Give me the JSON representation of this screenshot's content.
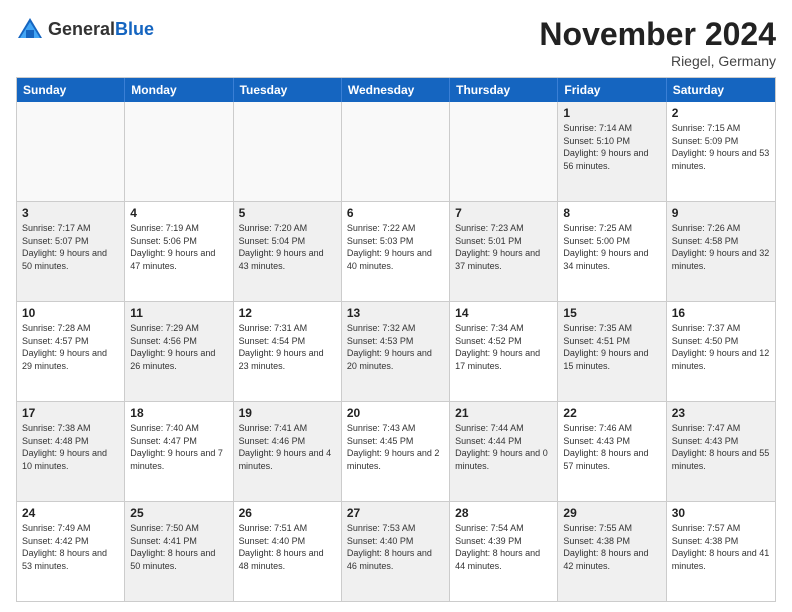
{
  "logo": {
    "general": "General",
    "blue": "Blue"
  },
  "title": "November 2024",
  "subtitle": "Riegel, Germany",
  "headers": [
    "Sunday",
    "Monday",
    "Tuesday",
    "Wednesday",
    "Thursday",
    "Friday",
    "Saturday"
  ],
  "rows": [
    [
      {
        "day": "",
        "info": "",
        "empty": true
      },
      {
        "day": "",
        "info": "",
        "empty": true
      },
      {
        "day": "",
        "info": "",
        "empty": true
      },
      {
        "day": "",
        "info": "",
        "empty": true
      },
      {
        "day": "",
        "info": "",
        "empty": true
      },
      {
        "day": "1",
        "info": "Sunrise: 7:14 AM\nSunset: 5:10 PM\nDaylight: 9 hours and 56 minutes.",
        "shaded": true
      },
      {
        "day": "2",
        "info": "Sunrise: 7:15 AM\nSunset: 5:09 PM\nDaylight: 9 hours and 53 minutes.",
        "shaded": false
      }
    ],
    [
      {
        "day": "3",
        "info": "Sunrise: 7:17 AM\nSunset: 5:07 PM\nDaylight: 9 hours and 50 minutes.",
        "shaded": true
      },
      {
        "day": "4",
        "info": "Sunrise: 7:19 AM\nSunset: 5:06 PM\nDaylight: 9 hours and 47 minutes.",
        "shaded": false
      },
      {
        "day": "5",
        "info": "Sunrise: 7:20 AM\nSunset: 5:04 PM\nDaylight: 9 hours and 43 minutes.",
        "shaded": true
      },
      {
        "day": "6",
        "info": "Sunrise: 7:22 AM\nSunset: 5:03 PM\nDaylight: 9 hours and 40 minutes.",
        "shaded": false
      },
      {
        "day": "7",
        "info": "Sunrise: 7:23 AM\nSunset: 5:01 PM\nDaylight: 9 hours and 37 minutes.",
        "shaded": true
      },
      {
        "day": "8",
        "info": "Sunrise: 7:25 AM\nSunset: 5:00 PM\nDaylight: 9 hours and 34 minutes.",
        "shaded": false
      },
      {
        "day": "9",
        "info": "Sunrise: 7:26 AM\nSunset: 4:58 PM\nDaylight: 9 hours and 32 minutes.",
        "shaded": true
      }
    ],
    [
      {
        "day": "10",
        "info": "Sunrise: 7:28 AM\nSunset: 4:57 PM\nDaylight: 9 hours and 29 minutes.",
        "shaded": false
      },
      {
        "day": "11",
        "info": "Sunrise: 7:29 AM\nSunset: 4:56 PM\nDaylight: 9 hours and 26 minutes.",
        "shaded": true
      },
      {
        "day": "12",
        "info": "Sunrise: 7:31 AM\nSunset: 4:54 PM\nDaylight: 9 hours and 23 minutes.",
        "shaded": false
      },
      {
        "day": "13",
        "info": "Sunrise: 7:32 AM\nSunset: 4:53 PM\nDaylight: 9 hours and 20 minutes.",
        "shaded": true
      },
      {
        "day": "14",
        "info": "Sunrise: 7:34 AM\nSunset: 4:52 PM\nDaylight: 9 hours and 17 minutes.",
        "shaded": false
      },
      {
        "day": "15",
        "info": "Sunrise: 7:35 AM\nSunset: 4:51 PM\nDaylight: 9 hours and 15 minutes.",
        "shaded": true
      },
      {
        "day": "16",
        "info": "Sunrise: 7:37 AM\nSunset: 4:50 PM\nDaylight: 9 hours and 12 minutes.",
        "shaded": false
      }
    ],
    [
      {
        "day": "17",
        "info": "Sunrise: 7:38 AM\nSunset: 4:48 PM\nDaylight: 9 hours and 10 minutes.",
        "shaded": true
      },
      {
        "day": "18",
        "info": "Sunrise: 7:40 AM\nSunset: 4:47 PM\nDaylight: 9 hours and 7 minutes.",
        "shaded": false
      },
      {
        "day": "19",
        "info": "Sunrise: 7:41 AM\nSunset: 4:46 PM\nDaylight: 9 hours and 4 minutes.",
        "shaded": true
      },
      {
        "day": "20",
        "info": "Sunrise: 7:43 AM\nSunset: 4:45 PM\nDaylight: 9 hours and 2 minutes.",
        "shaded": false
      },
      {
        "day": "21",
        "info": "Sunrise: 7:44 AM\nSunset: 4:44 PM\nDaylight: 9 hours and 0 minutes.",
        "shaded": true
      },
      {
        "day": "22",
        "info": "Sunrise: 7:46 AM\nSunset: 4:43 PM\nDaylight: 8 hours and 57 minutes.",
        "shaded": false
      },
      {
        "day": "23",
        "info": "Sunrise: 7:47 AM\nSunset: 4:43 PM\nDaylight: 8 hours and 55 minutes.",
        "shaded": true
      }
    ],
    [
      {
        "day": "24",
        "info": "Sunrise: 7:49 AM\nSunset: 4:42 PM\nDaylight: 8 hours and 53 minutes.",
        "shaded": false
      },
      {
        "day": "25",
        "info": "Sunrise: 7:50 AM\nSunset: 4:41 PM\nDaylight: 8 hours and 50 minutes.",
        "shaded": true
      },
      {
        "day": "26",
        "info": "Sunrise: 7:51 AM\nSunset: 4:40 PM\nDaylight: 8 hours and 48 minutes.",
        "shaded": false
      },
      {
        "day": "27",
        "info": "Sunrise: 7:53 AM\nSunset: 4:40 PM\nDaylight: 8 hours and 46 minutes.",
        "shaded": true
      },
      {
        "day": "28",
        "info": "Sunrise: 7:54 AM\nSunset: 4:39 PM\nDaylight: 8 hours and 44 minutes.",
        "shaded": false
      },
      {
        "day": "29",
        "info": "Sunrise: 7:55 AM\nSunset: 4:38 PM\nDaylight: 8 hours and 42 minutes.",
        "shaded": true
      },
      {
        "day": "30",
        "info": "Sunrise: 7:57 AM\nSunset: 4:38 PM\nDaylight: 8 hours and 41 minutes.",
        "shaded": false
      }
    ]
  ]
}
